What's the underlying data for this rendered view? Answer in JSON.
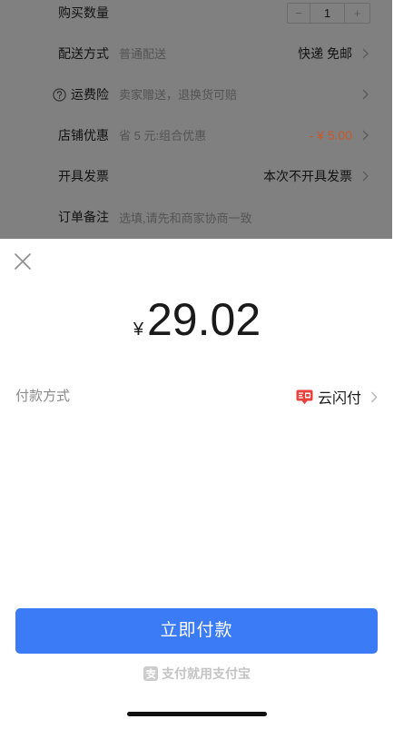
{
  "order_form": {
    "quantity": {
      "label": "购买数量",
      "minus": "−",
      "value": "1",
      "plus": "+"
    },
    "delivery": {
      "label": "配送方式",
      "hint": "普通配送",
      "value": "快递 免邮"
    },
    "shipping_insurance": {
      "label": "运费险",
      "hint": "卖家赠送，退换货可赔"
    },
    "store_discount": {
      "label": "店铺优惠",
      "hint": "省 5 元:组合优惠",
      "value": "- ¥ 5.00"
    },
    "invoice": {
      "label": "开具发票",
      "value": "本次不开具发票"
    },
    "remark": {
      "label": "订单备注",
      "placeholder": "选填,请先和商家协商一致"
    }
  },
  "payment_sheet": {
    "amount": {
      "currency": "¥",
      "value": "29.02"
    },
    "payment_method": {
      "label": "付款方式",
      "value": "云闪付"
    },
    "pay_button_label": "立即付款",
    "footer_slogan": "支付就用支付宝"
  },
  "icons": {
    "close": "close-icon",
    "help": "question-circle-icon",
    "chevron": "chevron-right-icon",
    "payment_method": "unionpay-quickpass-icon",
    "slogan": "alipay-icon"
  },
  "colors": {
    "accent": "#3b7bf6",
    "discount": "#c8572a",
    "mask": "#808080",
    "sheet_background": "#ffffff"
  }
}
